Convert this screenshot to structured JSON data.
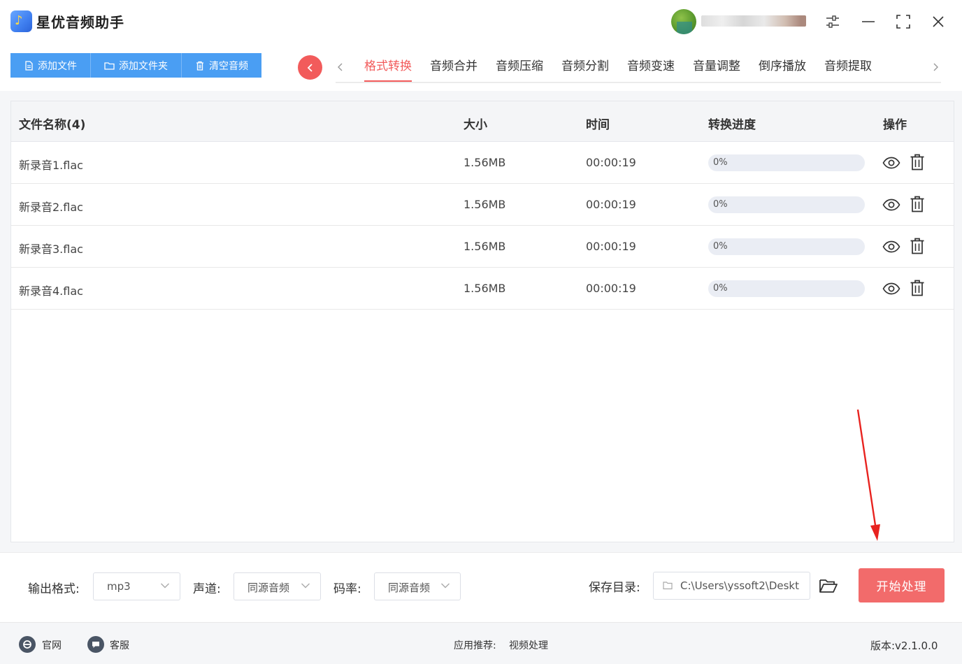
{
  "window": {
    "title": "星优音频助手"
  },
  "toolbar": {
    "add_file": "添加文件",
    "add_folder": "添加文件夹",
    "clear": "清空音频"
  },
  "tabs": [
    {
      "label": "格式转换",
      "active": true
    },
    {
      "label": "音频合并",
      "active": false
    },
    {
      "label": "音频压缩",
      "active": false
    },
    {
      "label": "音频分割",
      "active": false
    },
    {
      "label": "音频变速",
      "active": false
    },
    {
      "label": "音量调整",
      "active": false
    },
    {
      "label": "倒序播放",
      "active": false
    },
    {
      "label": "音频提取",
      "active": false
    }
  ],
  "table": {
    "headers": {
      "name": "文件名称(4)",
      "size": "大小",
      "time": "时间",
      "progress": "转换进度",
      "actions": "操作"
    },
    "rows": [
      {
        "name": "新录音1.flac",
        "size": "1.56MB",
        "time": "00:00:19",
        "progress_text": "0%",
        "progress": 0
      },
      {
        "name": "新录音2.flac",
        "size": "1.56MB",
        "time": "00:00:19",
        "progress_text": "0%",
        "progress": 0
      },
      {
        "name": "新录音3.flac",
        "size": "1.56MB",
        "time": "00:00:19",
        "progress_text": "0%",
        "progress": 0
      },
      {
        "name": "新录音4.flac",
        "size": "1.56MB",
        "time": "00:00:19",
        "progress_text": "0%",
        "progress": 0
      }
    ]
  },
  "settings": {
    "format_label": "输出格式:",
    "format_value": "mp3",
    "channel_label": "声道:",
    "channel_value": "同源音频",
    "bitrate_label": "码率:",
    "bitrate_value": "同源音频",
    "save_label": "保存目录:",
    "save_path": "C:\\Users\\yssoft2\\Deskt",
    "start_button": "开始处理"
  },
  "footer": {
    "website": "官网",
    "support": "客服",
    "recommend_label": "应用推荐:",
    "recommend_link": "视频处理",
    "version": "版本:v2.1.0.0"
  },
  "colors": {
    "accent_blue": "#4a9ef3",
    "accent_red": "#f25b5b",
    "start_button": "#f26b6b"
  },
  "icons": {
    "logo": "music-note-icon",
    "settings": "sliders-icon",
    "minimize": "minimize-icon",
    "maximize": "maximize-icon",
    "close": "close-icon",
    "preview": "eye-icon",
    "delete": "trash-icon",
    "folder": "folder-open-icon"
  }
}
